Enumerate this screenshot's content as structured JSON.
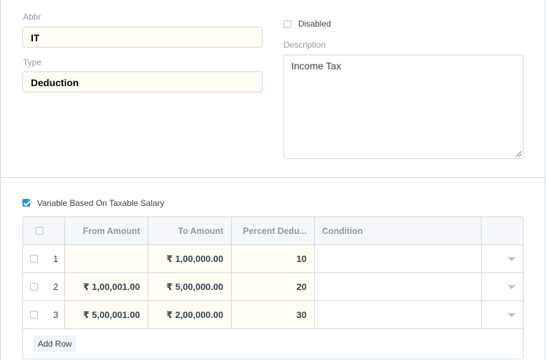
{
  "form": {
    "abbr_label": "Abbr",
    "abbr_value": "IT",
    "type_label": "Type",
    "type_value": "Deduction",
    "disabled_label": "Disabled",
    "description_label": "Description",
    "description_value": "Income Tax",
    "variable_label": "Variable Based On Taxable Salary"
  },
  "grid": {
    "columns": [
      "From Amount",
      "To Amount",
      "Percent Dedu...",
      "Condition"
    ],
    "rows": [
      {
        "idx": "1",
        "from": "",
        "to": "₹ 1,00,000.00",
        "percent": "10",
        "condition": ""
      },
      {
        "idx": "2",
        "from": "₹ 1,00,001.00",
        "to": "₹ 5,00,000.00",
        "percent": "20",
        "condition": ""
      },
      {
        "idx": "3",
        "from": "₹ 5,00,001.00",
        "to": "₹ 2,00,000.00",
        "percent": "30",
        "condition": ""
      }
    ],
    "add_row_label": "Add Row"
  },
  "colors": {
    "accent": "#2490ef",
    "border": "#d1d8dd",
    "label": "#8d99a6",
    "input_bg": "#fffdf4"
  }
}
